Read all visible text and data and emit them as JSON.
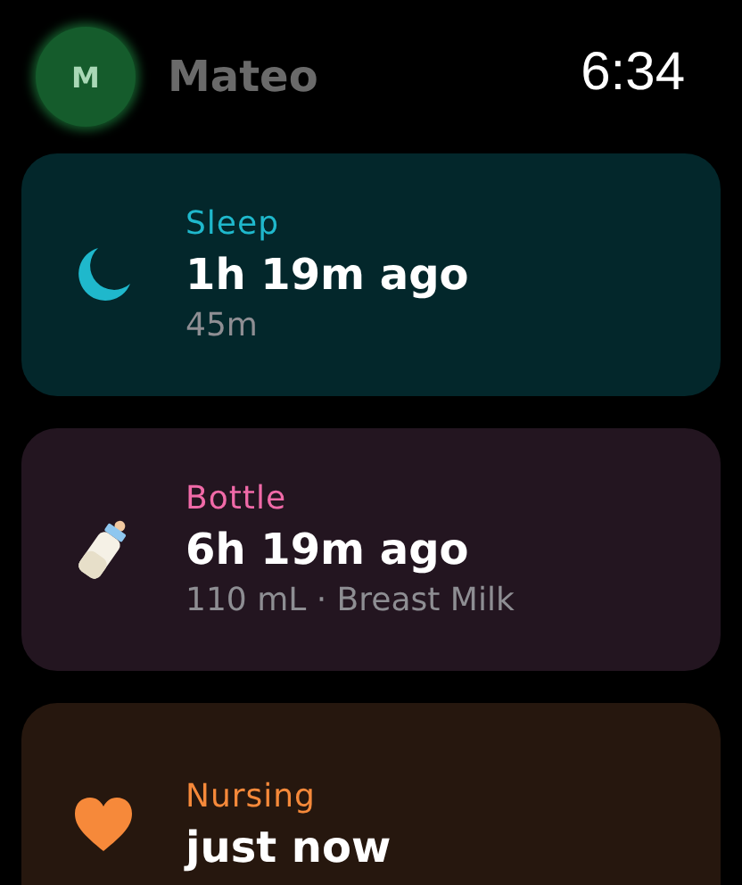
{
  "header": {
    "avatar_initial": "M",
    "name": "Mateo",
    "time": "6:34"
  },
  "cards": [
    {
      "kind": "sleep",
      "category": "Sleep",
      "color": "#1fb8cc",
      "ago": "1h 19m ago",
      "detail": "45m"
    },
    {
      "kind": "bottle",
      "category": "Bottle",
      "color": "#f06aa8",
      "ago": "6h 19m ago",
      "detail": "110 mL · Breast Milk"
    },
    {
      "kind": "nursing",
      "category": "Nursing",
      "color": "#f6893a",
      "ago": "just now"
    }
  ]
}
